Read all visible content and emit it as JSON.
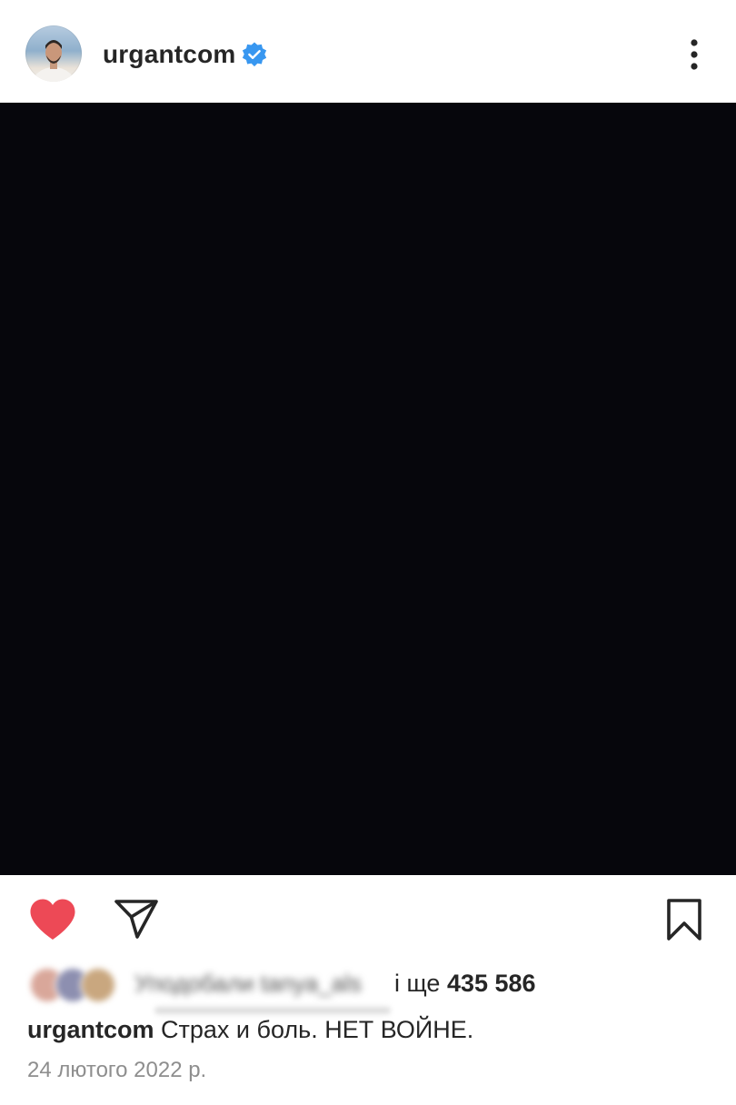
{
  "post": {
    "author": {
      "username": "urgantcom",
      "verified": true
    },
    "media": {
      "background_color": "#06060c"
    },
    "actions": {
      "liked": true,
      "like_color": "#ed4956"
    },
    "likes": {
      "liked_by_text": "Уподобали tanya_als",
      "more_prefix": "і ще ",
      "more_count": "435 586"
    },
    "caption": {
      "username": "urgantcom",
      "text": "Страх и боль. НЕТ ВОЙНЕ."
    },
    "date": "24 лютого 2022 р."
  },
  "icons": {
    "verified": "verified-badge-icon",
    "more": "more-options-icon",
    "like": "heart-filled-icon",
    "share": "paper-plane-icon",
    "save": "bookmark-icon"
  },
  "colors": {
    "verified_blue": "#3897f0",
    "text_primary": "#262626",
    "text_secondary": "#8e8e8e"
  }
}
